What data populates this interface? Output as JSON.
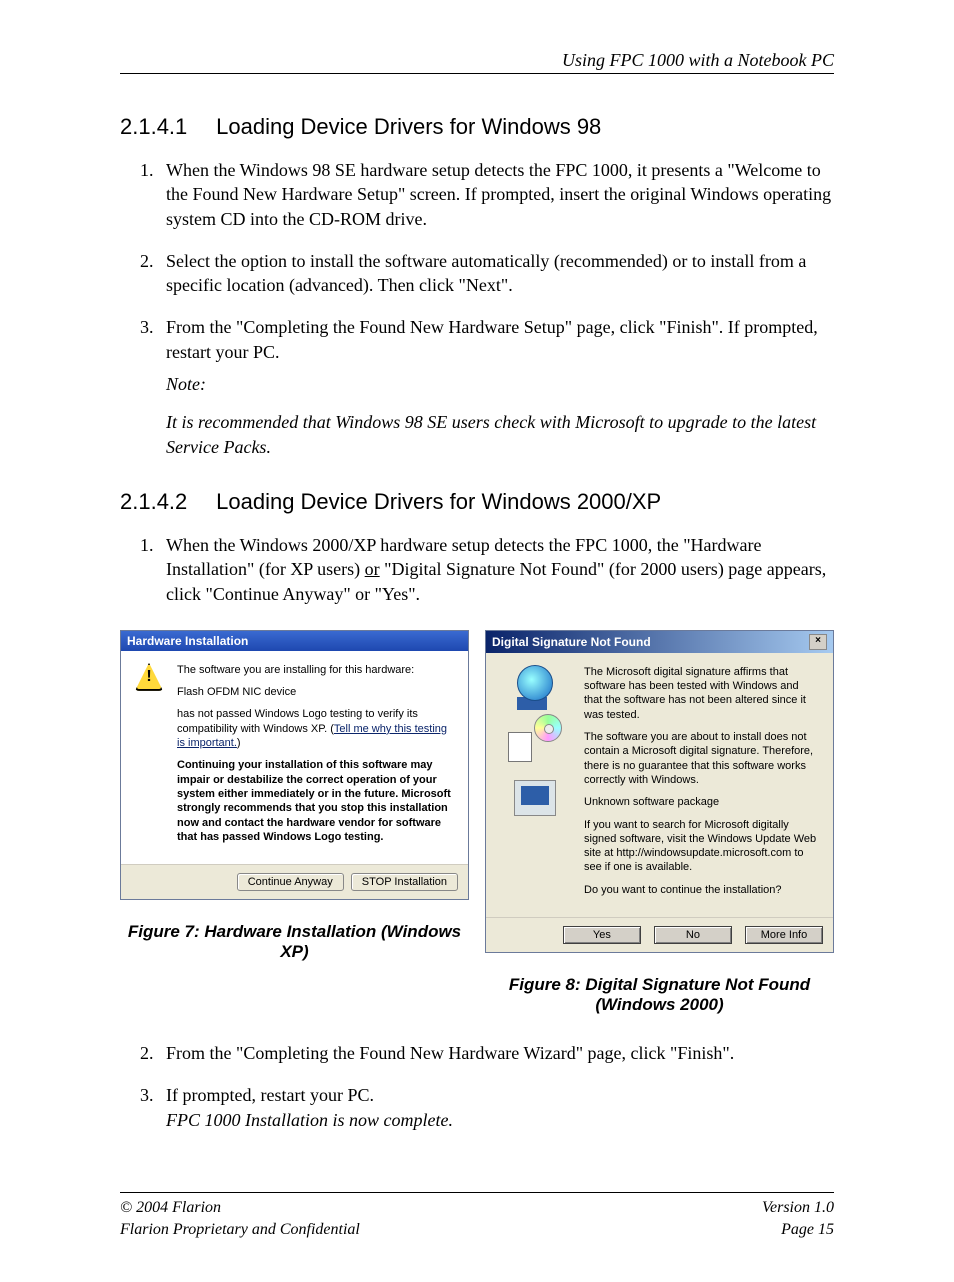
{
  "header": {
    "running_title": "Using FPC 1000 with a Notebook PC"
  },
  "section1": {
    "number": "2.1.4.1",
    "title": "Loading Device Drivers for Windows 98",
    "steps": [
      "When the Windows 98 SE hardware setup detects the FPC 1000, it presents a \"Welcome to the Found New Hardware Setup\" screen. If prompted, insert the original Windows operating system CD into the CD-ROM drive.",
      "Select the option to install the software automatically (recommended) or to install from a specific location (advanced). Then click \"Next\".",
      "From the \"Completing the Found New Hardware Setup\" page, click \"Finish\". If prompted, restart your PC."
    ],
    "note_label": "Note:",
    "note_body": "It is recommended that Windows 98 SE users check with Microsoft to upgrade to the latest Service Packs."
  },
  "section2": {
    "number": "2.1.4.2",
    "title": "Loading Device Drivers for Windows 2000/XP",
    "step1_pre": "When the Windows 2000/XP hardware setup detects the FPC 1000, the \"Hardware Installation\" (for XP users) ",
    "step1_or": "or",
    "step1_post": " \"Digital Signature Not Found\" (for 2000 users) page appears, click \"Continue Anyway\" or \"Yes\".",
    "step2": "From the \"Completing the Found New Hardware Wizard\" page, click \"Finish\".",
    "step3": "If prompted, restart your PC.",
    "step3_italic": "FPC 1000 Installation is now complete."
  },
  "dialog_xp": {
    "title": "Hardware Installation",
    "line1": "The software you are installing for this hardware:",
    "device": "Flash OFDM NIC device",
    "line2a": "has not passed Windows Logo testing to verify its compatibility with Windows XP. (",
    "link": "Tell me why this testing is important.",
    "line2b": ")",
    "warn": "Continuing your installation of this software may impair or destabilize the correct operation of your system either immediately or in the future. Microsoft strongly recommends that you stop this installation now and contact the hardware vendor for software that has passed Windows Logo testing.",
    "btn_continue": "Continue Anyway",
    "btn_stop": "STOP Installation"
  },
  "dialog_2k": {
    "title": "Digital Signature Not Found",
    "close": "×",
    "p1": "The Microsoft digital signature affirms that software has been tested with Windows and that the software has not been altered since it was tested.",
    "p2": "The software you are about to install does not contain a Microsoft digital signature. Therefore, there is no guarantee that this software works correctly with Windows.",
    "p3": "Unknown software package",
    "p4": "If you want to search for Microsoft digitally signed software, visit the Windows Update Web site at http://windowsupdate.microsoft.com to see if one is available.",
    "p5": "Do you want to continue the installation?",
    "btn_yes": "Yes",
    "btn_no": "No",
    "btn_more": "More Info"
  },
  "captions": {
    "fig7": "Figure 7: Hardware Installation (Windows XP)",
    "fig8": "Figure 8: Digital Signature Not Found (Windows 2000)"
  },
  "footer": {
    "copyright": "© 2004 Flarion",
    "confidential": "Flarion Proprietary and Confidential",
    "version": "Version 1.0",
    "page": "Page 15"
  }
}
